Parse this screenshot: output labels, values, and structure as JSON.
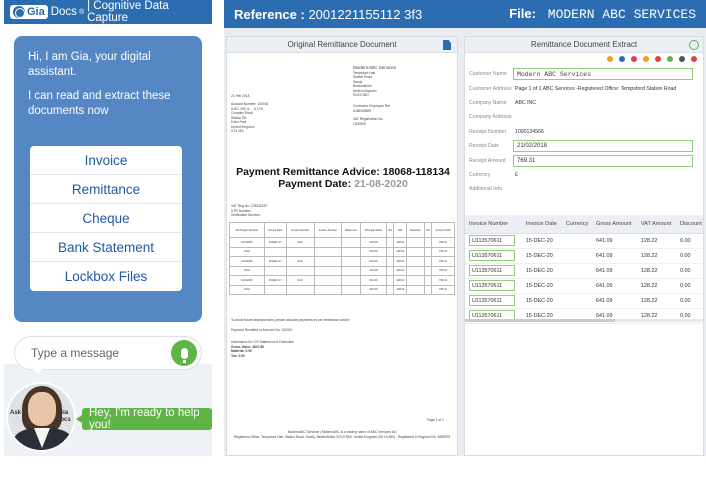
{
  "chat": {
    "brand": "Gia",
    "brand_suffix": "Docs",
    "header_text": "| Cognitive Data Capture",
    "greeting": "Hi, I am Gia, your digital assistant.",
    "intro": "I can read and extract these documents now",
    "options": [
      "Invoice",
      "Remittance",
      "Cheque",
      "Bank Statement",
      "Lockbox Files"
    ],
    "input_placeholder": "Type a message",
    "ask_label": "Ask",
    "avatar_label_1": "Gia",
    "avatar_label_2": "Docs",
    "ready_message": "Hey, I'm ready to help you!"
  },
  "app": {
    "reference_label": "Reference :",
    "reference_value": "2001221155112 3f3",
    "file_label": "File:",
    "file_value": "MODERN ABC SERVICES"
  },
  "document": {
    "title": "Original Remittance Document",
    "header_lines": [
      "ModernABC Services",
      "Tempsford Hall",
      "Station Road",
      "Sandy",
      "Bedfordshire",
      "United Kingdom",
      "SG19 2BD"
    ],
    "date_line": "21 Feb 2018",
    "address_lines": [
      "Account Number: 100004",
      "A.BC. INC & ... & LTD",
      "Complex Road",
      "Station Rd",
      "Eden Park",
      "United Kingdom",
      "ST4 4E1"
    ],
    "vat_right": [
      "Contractor Employee Ref",
      "A1BE26B89",
      "VAT Registration No.",
      "1000000"
    ],
    "payment_advice": "Payment Remittance Advice: 18068-118134",
    "payment_date_label": "Payment Date:",
    "payment_date_value": "21-08-2020",
    "vat_lines": [
      "VAT Reg No: 27834021F",
      "UTR Number:",
      "Verification Number:"
    ],
    "table_headers": [
      "Job Project Number",
      "Invoice Date",
      "Invoice Number",
      "Invoice Number",
      "Reference",
      "Principal Value",
      "Net",
      "VAT",
      "Retention",
      "Tax",
      "Amount Paid"
    ],
    "table_rows": [
      [
        "12411300",
        "15-DEC-17",
        "Rich",
        "",
        "",
        "641.09",
        "",
        "128.22",
        "",
        "",
        "769.31"
      ],
      [
        "Total",
        "",
        "",
        "",
        "",
        "641.09",
        "",
        "128.22",
        "",
        "",
        "769.31"
      ],
      [
        "12411300",
        "15-DEC-17",
        "Rich",
        "",
        "",
        "641.09",
        "",
        "128.22",
        "",
        "",
        "769.31"
      ],
      [
        "Total",
        "",
        "",
        "",
        "",
        "641.09",
        "",
        "128.22",
        "",
        "",
        "769.31"
      ],
      [
        "12411300",
        "15-DEC-17",
        "Rich",
        "",
        "",
        "641.09",
        "",
        "128.22",
        "",
        "",
        "769.31"
      ],
      [
        "Total",
        "",
        "",
        "",
        "",
        "641.09",
        "",
        "128.22",
        "",
        "",
        "769.31"
      ]
    ],
    "footer_notes": [
      "To avoid future discrepancies, please allocate payments as per remittance advice",
      "Payment Remitted to Account No. 100001",
      "Information for CIS Statement of Deduction",
      "Gross Value: 3847.86",
      "Material: 0.00",
      "Tax: 0.00"
    ],
    "page_no": "Page 1 of 1",
    "bottom_lines": [
      "ModernABC Services | ModernABC is a trading name of ABC Services Ltd",
      "Registered Office: Tempsford Hall, Station Road, Sandy, Bedfordshire SG19 2BD, United Kingdom (05 16 080) - Registered in England No. 3655975"
    ]
  },
  "extract": {
    "title": "Remittance Document Extract",
    "fields": [
      {
        "label": "Customer Name",
        "value": "Modern ABC Services",
        "boxed": true,
        "mono": true
      },
      {
        "label": "Customer Address",
        "value": "Page 1 of 1 ABC Services -Registered Office: Tempsford Station Road",
        "boxed": false
      },
      {
        "label": "Company Name",
        "value": "ABC INC",
        "boxed": false
      },
      {
        "label": "Company Address",
        "value": "",
        "boxed": false
      },
      {
        "label": "Receipt Number",
        "value": "1000134566",
        "boxed": false
      },
      {
        "label": "Receipt Date",
        "value": "21/02/2018",
        "boxed": true
      },
      {
        "label": "Receipt Amount",
        "value": "769.31",
        "boxed": true
      },
      {
        "label": "Currency",
        "value": "£",
        "boxed": false
      },
      {
        "label": "Additional Info.",
        "value": "",
        "boxed": false
      }
    ],
    "columns": [
      "Invoice Number",
      "Invoice Date",
      "Currency",
      "Gross Amount",
      "VAT Amount",
      "Discount A"
    ],
    "rows": [
      [
        "U113570611",
        "15-DEC-20",
        "",
        "641.09",
        "128.22",
        "0.00"
      ],
      [
        "U113570611",
        "15-DEC-20",
        "",
        "641.09",
        "128.22",
        "0.00"
      ],
      [
        "U113570611",
        "15-DEC-20",
        "",
        "641.09",
        "128.22",
        "0.00"
      ],
      [
        "U113570611",
        "15-DEC-20",
        "",
        "641.09",
        "128.22",
        "0.00"
      ],
      [
        "U113570611",
        "15-DEC-20",
        "",
        "641.09",
        "128.22",
        "0.00"
      ],
      [
        "U113570611",
        "15-DEC-20",
        "",
        "641.09",
        "128.22",
        "0.00"
      ]
    ],
    "toolbar_colors": [
      "#f0a020",
      "#2c6db1",
      "#e04040",
      "#f0a020",
      "#e04040",
      "#5fb544",
      "#555555",
      "#e04040"
    ]
  },
  "colors": {
    "brand_blue": "#2c6db1",
    "bubble_blue": "#5587c4",
    "green": "#5fb544"
  }
}
